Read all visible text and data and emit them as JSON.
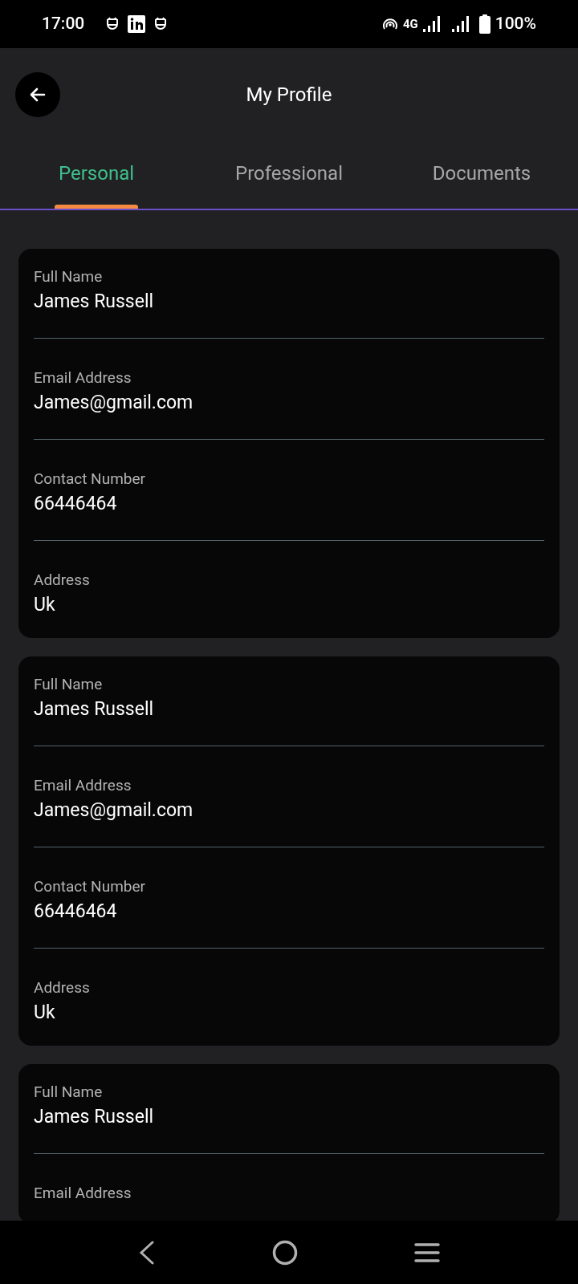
{
  "status_bar": {
    "time": "17:00",
    "network": "4G",
    "battery": "100%"
  },
  "header": {
    "title": "My Profile"
  },
  "tabs": [
    {
      "label": "Personal",
      "selected": true
    },
    {
      "label": "Professional",
      "selected": false
    },
    {
      "label": "Documents",
      "selected": false
    }
  ],
  "cards": [
    {
      "fields": [
        {
          "label": "Full Name",
          "value": "James Russell"
        },
        {
          "label": "Email Address",
          "value": "James@gmail.com"
        },
        {
          "label": "Contact Number",
          "value": "66446464"
        },
        {
          "label": "Address",
          "value": "Uk"
        }
      ]
    },
    {
      "fields": [
        {
          "label": "Full Name",
          "value": "James Russell"
        },
        {
          "label": "Email Address",
          "value": "James@gmail.com"
        },
        {
          "label": "Contact Number",
          "value": "66446464"
        },
        {
          "label": "Address",
          "value": "Uk"
        }
      ]
    },
    {
      "fields": [
        {
          "label": "Full Name",
          "value": "James Russell"
        },
        {
          "label": "Email Address"
        }
      ]
    }
  ]
}
